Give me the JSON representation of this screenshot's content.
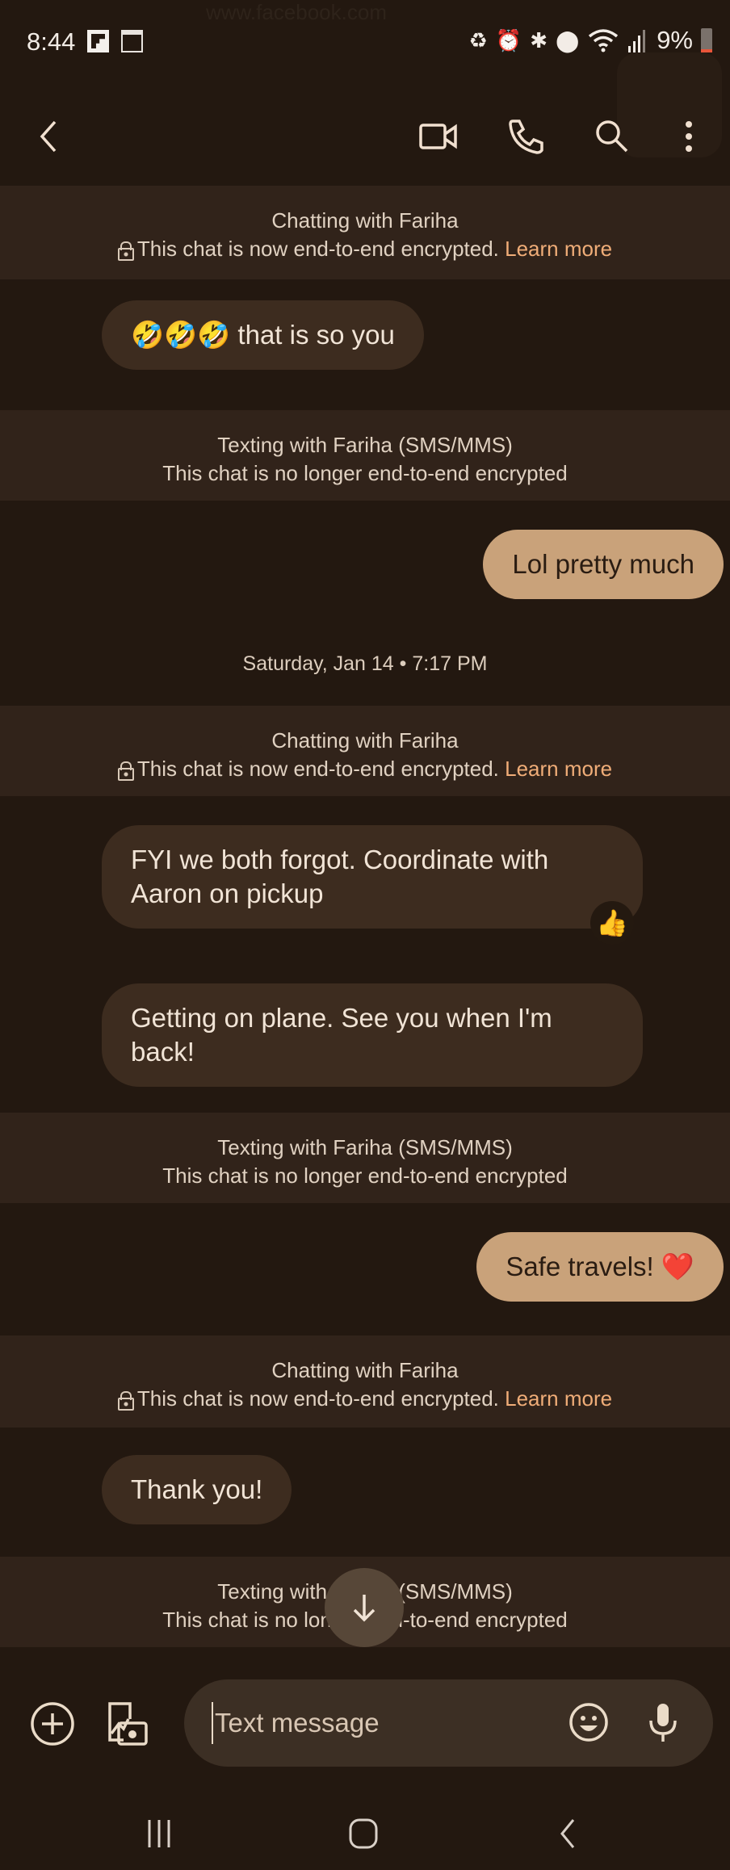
{
  "status_bar": {
    "ghost_url": "www.facebook.com",
    "time": "8:44",
    "left_icons": [
      "flipboard-icon",
      "news-icon"
    ],
    "right_icons": [
      "battery-saver-icon",
      "alarm-icon",
      "bluetooth-icon",
      "location-icon",
      "wifi-icon",
      "signal-icon"
    ],
    "battery_percent": "9%",
    "battery_level": 0.09,
    "battery_color": "#e8553a"
  },
  "app_bar": {
    "back_icon": "chevron-left-icon",
    "actions": [
      "video-call-icon",
      "phone-icon",
      "search-icon",
      "more-vert-icon"
    ]
  },
  "conversation": {
    "contact": "Fariha",
    "accent_color": "#f0ad78",
    "incoming_bubble_color": "#3d2c1f",
    "outgoing_bubble_color": "#c9a27a",
    "items": [
      {
        "type": "banner_e2ee",
        "title": "Chatting with Fariha",
        "text": "This chat is now end-to-end encrypted.",
        "link": "Learn more"
      },
      {
        "type": "incoming",
        "text": "🤣🤣🤣 that is so you"
      },
      {
        "type": "banner_sms",
        "title": "Texting with Fariha (SMS/MMS)",
        "text": "This chat is no longer end-to-end encrypted"
      },
      {
        "type": "outgoing",
        "text": "Lol pretty much"
      },
      {
        "type": "date",
        "text": "Saturday, Jan 14 • 7:17 PM"
      },
      {
        "type": "banner_e2ee",
        "title": "Chatting with Fariha",
        "text": "This chat is now end-to-end encrypted.",
        "link": "Learn more"
      },
      {
        "type": "incoming",
        "text": "FYI we both forgot. Coordinate with Aaron on pickup",
        "reaction": "👍"
      },
      {
        "type": "incoming",
        "text": "Getting on plane. See you when I'm back!"
      },
      {
        "type": "banner_sms",
        "title": "Texting with Fariha (SMS/MMS)",
        "text": "This chat is no longer end-to-end encrypted"
      },
      {
        "type": "outgoing",
        "text": "Safe travels! ❤️"
      },
      {
        "type": "banner_e2ee",
        "title": "Chatting with Fariha",
        "text": "This chat is now end-to-end encrypted.",
        "link": "Learn more"
      },
      {
        "type": "incoming",
        "text": "Thank you!"
      },
      {
        "type": "banner_sms",
        "title": "Texting with Fariha (SMS/MMS)",
        "text": "This chat is no longer end-to-end encrypted"
      }
    ]
  },
  "scroll_down_icon": "arrow-down-icon",
  "composer": {
    "placeholder": "Text message",
    "value": "",
    "icons": [
      "add-circle-icon",
      "gallery-camera-icon",
      "emoji-icon",
      "microphone-icon"
    ]
  },
  "nav_bar": {
    "buttons": [
      "recents-icon",
      "home-icon",
      "back-icon"
    ]
  }
}
